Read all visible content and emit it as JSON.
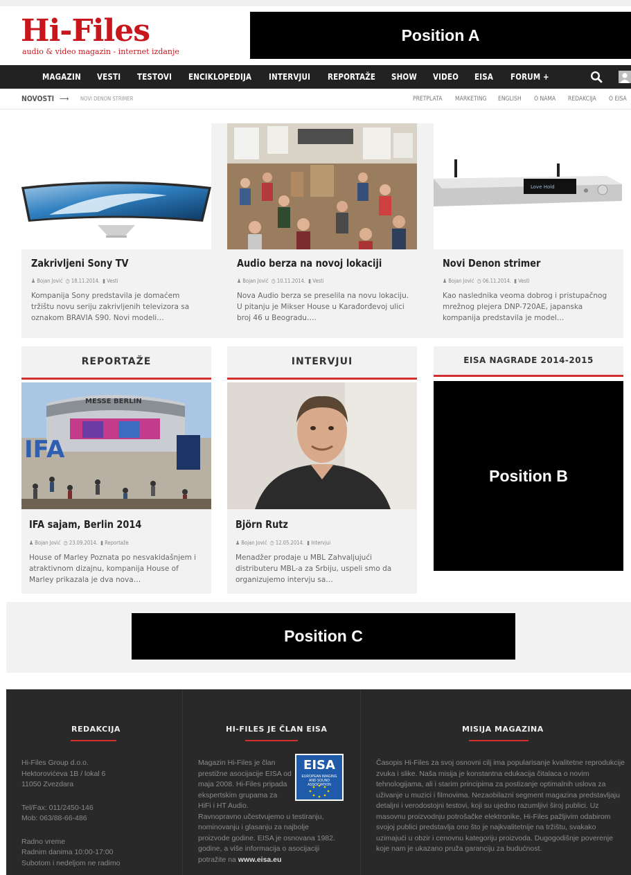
{
  "header": {
    "logo_main": "Hi-Files",
    "logo_sub": "audio & video magazin - internet izdanje",
    "ad_a": "Position A"
  },
  "nav": {
    "items": [
      "MAGAZIN",
      "VESTI",
      "TESTOVI",
      "ENCIKLOPEDIJA",
      "INTERVJUI",
      "REPORTAŽE",
      "SHOW",
      "VIDEO",
      "EISA",
      "FORUM +"
    ],
    "icons": [
      "search-icon",
      "user-icon"
    ]
  },
  "subnav": {
    "news_label": "NOVOSTI",
    "arrow": "⟶",
    "ticker": "NOVI DENON STRIMER",
    "links": [
      "PRETPLATA",
      "MARKETING",
      "ENGLISH",
      "O NAMA",
      "REDAKCIJA",
      "O EISA"
    ]
  },
  "featured": [
    {
      "title": "Zakrivljeni Sony TV",
      "author": "Bojan Jović",
      "date": "18.11.2014.",
      "category": "Vesti",
      "excerpt": "Kompanija Sony predstavila je domaćem tržištu novu seriju zakrivljenih televizora sa oznakom BRAVIA S90. Novi modeli…"
    },
    {
      "title": "Audio berza na novoj lokaciji",
      "author": "Bojan Jović",
      "date": "10.11.2014.",
      "category": "Vesti",
      "excerpt": "Nova Audio berza se preselila na novu lokaciju. U pitanju je Mikser House u Karađorđevoj ulici broj 46 u Beogradu…."
    },
    {
      "title": "Novi Denon strimer",
      "author": "Bojan Jović",
      "date": "06.11.2014.",
      "category": "Vesti",
      "excerpt": "Kao naslednika veoma dobrog i pristupačnog mrežnog plejera DNP-720AE, japanska kompanija predstavila je model…"
    }
  ],
  "sections": {
    "reportaze": {
      "heading": "REPORTAŽE",
      "title": "IFA sajam, Berlin 2014",
      "author": "Bojan Jović",
      "date": "23.09.2014.",
      "category": "Reportaže",
      "excerpt": "House of Marley Poznata po nesvakidašnjem i atraktivnom dizajnu, kompanija House of Marley prikazala je dva nova…",
      "image_text": "IFA",
      "image_sign": "MESSE BERLIN"
    },
    "intervjui": {
      "heading": "INTERVJUI",
      "title": "Björn Rutz",
      "author": "Bojan Jović",
      "date": "12.05.2014.",
      "category": "Intervjui",
      "excerpt": "Menadžer prodaje u MBL Zahvaljujući distributeru MBL-a za Srbiju, uspeli smo da organizujemo intervju sa…"
    },
    "eisa": {
      "heading": "EISA NAGRADE 2014-2015",
      "ad_b": "Position B"
    }
  },
  "ad_c": "Position C",
  "footer": {
    "redakcija": {
      "heading": "REDAKCIJA",
      "lines": [
        "Hi-Files Group d.o.o.",
        "Hektorovićeva 1B / lokal 6",
        "11050 Zvezdara",
        "Tel/Fax: 011/2450-146",
        "Mob: 063/88-66-486",
        "Radno vreme",
        "Radnim danima 10:00-17:00",
        "Subotom i nedeljom ne radimo"
      ]
    },
    "eisa": {
      "heading": "HI-FILES JE ČLAN EISA",
      "lines": [
        "Magazin Hi-Files je član",
        "prestižne asocijacije EISA od",
        "maja 2008. Hi-Files pripada",
        "ekspertskim grupama za",
        "HiFi i HT Audio.",
        "Ravnopravno učestvujemo u testiranju,",
        "nominovanju i glasanju za najbolje",
        "proizvode godine. EISA je osnovana 1982.",
        "godine, a više informacija o asocijaciji"
      ],
      "last_prefix": "potražite na ",
      "link": "www.eisa.eu",
      "logo_word": "EISA",
      "logo_sub": "EUROPEAN IMAGING AND SOUND ASSOCIATION"
    },
    "misija": {
      "heading": "MISIJA MAGAZINA",
      "text": "Časopis Hi-Files za svoj osnovni cilj ima popularisanje kvalitetne reprodukcije zvuka i slike. Naša misija je konstantna edukacija čitalaca o novim tehnologijama, ali i starim principima za postizanje optimalnih uslova za uživanje u muzici i filmovima. Nezaobilazni segment magazina predstavljaju detaljni i verodostojni testovi, koji su ujedno razumljivi široj publici. Uz masovnu proizvodnju potrošačke elektronike, Hi-Files pažljivim odabirom svojoj publici predstavlja ono što je najkvalitetnije na tržištu, svakako uzimajući u obzir i cenovnu kategoriju proizvoda. Dugogodišnje poverenje koje nam je ukazano pruža garanciju za budućnost."
    }
  }
}
